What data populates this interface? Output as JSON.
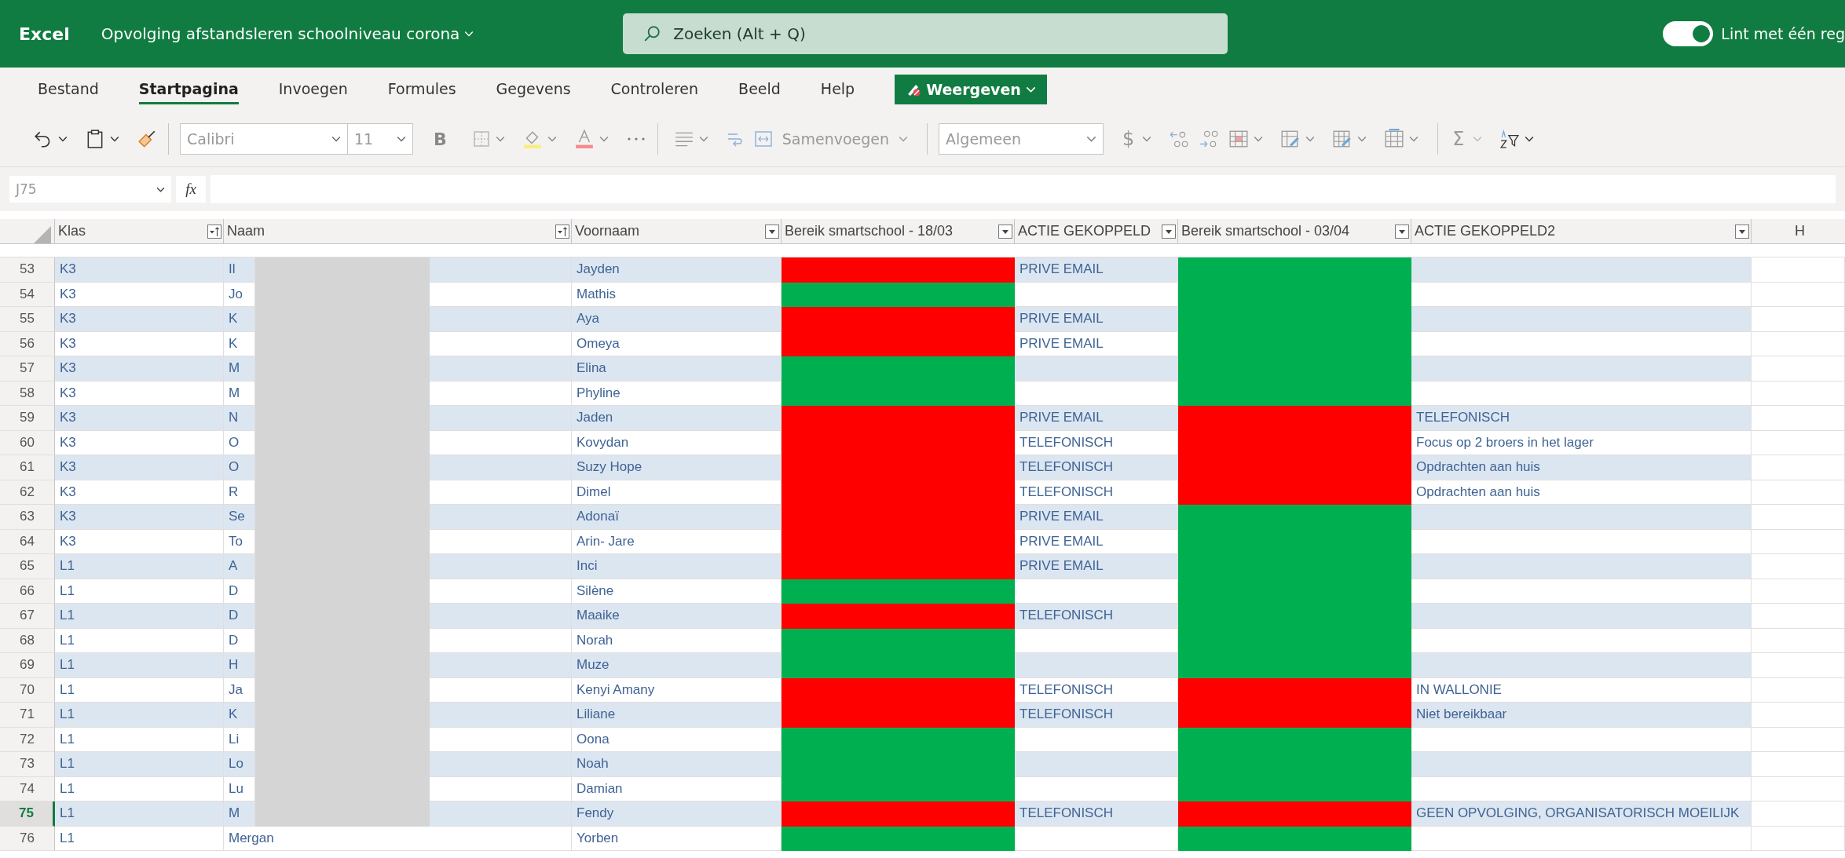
{
  "app_bar": {
    "app_name": "Excel",
    "document_title": "Opvolging afstandsleren schoolniveau corona",
    "search": {
      "placeholder": "Zoeken (Alt + Q)"
    },
    "ribbon_toggle": {
      "label": "Lint met één reg",
      "on": true
    }
  },
  "tabs": [
    {
      "label": "Bestand",
      "selected": false
    },
    {
      "label": "Startpagina",
      "selected": true
    },
    {
      "label": "Invoegen",
      "selected": false
    },
    {
      "label": "Formules",
      "selected": false
    },
    {
      "label": "Gegevens",
      "selected": false
    },
    {
      "label": "Controleren",
      "selected": false
    },
    {
      "label": "Beeld",
      "selected": false
    },
    {
      "label": "Help",
      "selected": false
    }
  ],
  "view_button": {
    "label": "Weergeven"
  },
  "toolbar": {
    "font": "Calibri",
    "font_size": "11",
    "bold": "B",
    "merge": "Samenvoegen",
    "number_format": "Algemeen",
    "currency": "$",
    "sum": "Σ"
  },
  "formula_bar": {
    "name_box": "J75",
    "fx": "fx"
  },
  "columns": [
    {
      "label": "Klas",
      "sorted": true
    },
    {
      "label": "Naam",
      "sorted": true
    },
    {
      "label": "Voornaam",
      "sorted": false
    },
    {
      "label": "Bereik smartschool - 18/03",
      "sorted": false
    },
    {
      "label": "ACTIE GEKOPPELD",
      "sorted": false
    },
    {
      "label": "Bereik smartschool - 03/04",
      "sorted": false
    },
    {
      "label": "ACTIE GEKOPPELD2",
      "sorted": false
    }
  ],
  "extra_column": "H",
  "rows": [
    {
      "number": "53",
      "klas": "K3",
      "naam": "Il",
      "redacted": true,
      "voornaam": "Jayden",
      "reached_1": false,
      "action_1": "PRIVE EMAIL",
      "reached_2": true,
      "action_2": "",
      "selected": false
    },
    {
      "number": "54",
      "klas": "K3",
      "naam": "Jo",
      "redacted": true,
      "voornaam": "Mathis",
      "reached_1": true,
      "action_1": "",
      "reached_2": true,
      "action_2": "",
      "selected": false
    },
    {
      "number": "55",
      "klas": "K3",
      "naam": "K",
      "redacted": true,
      "voornaam": "Aya",
      "reached_1": false,
      "action_1": "PRIVE EMAIL",
      "reached_2": true,
      "action_2": "",
      "selected": false
    },
    {
      "number": "56",
      "klas": "K3",
      "naam": "K",
      "redacted": true,
      "voornaam": "Omeya",
      "reached_1": false,
      "action_1": "PRIVE EMAIL",
      "reached_2": true,
      "action_2": "",
      "selected": false
    },
    {
      "number": "57",
      "klas": "K3",
      "naam": "M",
      "redacted": true,
      "voornaam": "Elina",
      "reached_1": true,
      "action_1": "",
      "reached_2": true,
      "action_2": "",
      "selected": false
    },
    {
      "number": "58",
      "klas": "K3",
      "naam": "M",
      "redacted": true,
      "voornaam": "Phyline",
      "reached_1": true,
      "action_1": "",
      "reached_2": true,
      "action_2": "",
      "selected": false
    },
    {
      "number": "59",
      "klas": "K3",
      "naam": "N",
      "redacted": true,
      "voornaam": "Jaden",
      "reached_1": false,
      "action_1": "PRIVE EMAIL",
      "reached_2": false,
      "action_2": "TELEFONISCH",
      "selected": false
    },
    {
      "number": "60",
      "klas": "K3",
      "naam": "O",
      "redacted": true,
      "voornaam": "Kovydan",
      "reached_1": false,
      "action_1": "TELEFONISCH",
      "reached_2": false,
      "action_2": "Focus op 2 broers in het lager",
      "selected": false
    },
    {
      "number": "61",
      "klas": "K3",
      "naam": "O",
      "redacted": true,
      "voornaam": "Suzy Hope",
      "reached_1": false,
      "action_1": "TELEFONISCH",
      "reached_2": false,
      "action_2": "Opdrachten aan huis",
      "selected": false
    },
    {
      "number": "62",
      "klas": "K3",
      "naam": "R",
      "redacted": true,
      "voornaam": "Dimel",
      "reached_1": false,
      "action_1": "TELEFONISCH",
      "reached_2": false,
      "action_2": "Opdrachten aan huis",
      "selected": false
    },
    {
      "number": "63",
      "klas": "K3",
      "naam": "Se",
      "redacted": true,
      "voornaam": "Adonaï",
      "reached_1": false,
      "action_1": "PRIVE EMAIL",
      "reached_2": true,
      "action_2": "",
      "selected": false
    },
    {
      "number": "64",
      "klas": "K3",
      "naam": "To",
      "redacted": true,
      "voornaam": "Arin- Jare",
      "reached_1": false,
      "action_1": "PRIVE EMAIL",
      "reached_2": true,
      "action_2": "",
      "selected": false
    },
    {
      "number": "65",
      "klas": "L1",
      "naam": "A",
      "redacted": true,
      "voornaam": "Inci",
      "reached_1": false,
      "action_1": "PRIVE EMAIL",
      "reached_2": true,
      "action_2": "",
      "selected": false
    },
    {
      "number": "66",
      "klas": "L1",
      "naam": "D",
      "redacted": true,
      "voornaam": "Silène",
      "reached_1": true,
      "action_1": "",
      "reached_2": true,
      "action_2": "",
      "selected": false
    },
    {
      "number": "67",
      "klas": "L1",
      "naam": "D",
      "redacted": true,
      "voornaam": "Maaike",
      "reached_1": false,
      "action_1": "TELEFONISCH",
      "reached_2": true,
      "action_2": "",
      "selected": false
    },
    {
      "number": "68",
      "klas": "L1",
      "naam": "D",
      "redacted": true,
      "voornaam": "Norah",
      "reached_1": true,
      "action_1": "",
      "reached_2": true,
      "action_2": "",
      "selected": false
    },
    {
      "number": "69",
      "klas": "L1",
      "naam": "H",
      "redacted": true,
      "voornaam": "Muze",
      "reached_1": true,
      "action_1": "",
      "reached_2": true,
      "action_2": "",
      "selected": false
    },
    {
      "number": "70",
      "klas": "L1",
      "naam": "Ja",
      "redacted": true,
      "voornaam": "Kenyi Amany",
      "reached_1": false,
      "action_1": "TELEFONISCH",
      "reached_2": false,
      "action_2": "IN WALLONIE",
      "selected": false
    },
    {
      "number": "71",
      "klas": "L1",
      "naam": "K",
      "redacted": true,
      "voornaam": "Liliane",
      "reached_1": false,
      "action_1": "TELEFONISCH",
      "reached_2": false,
      "action_2": "Niet bereikbaar",
      "selected": false
    },
    {
      "number": "72",
      "klas": "L1",
      "naam": "Li",
      "redacted": true,
      "voornaam": "Oona",
      "reached_1": true,
      "action_1": "",
      "reached_2": true,
      "action_2": "",
      "selected": false
    },
    {
      "number": "73",
      "klas": "L1",
      "naam": "Lo",
      "redacted": true,
      "voornaam": "Noah",
      "reached_1": true,
      "action_1": "",
      "reached_2": true,
      "action_2": "",
      "selected": false
    },
    {
      "number": "74",
      "klas": "L1",
      "naam": "Lu",
      "redacted": true,
      "voornaam": "Damian",
      "reached_1": true,
      "action_1": "",
      "reached_2": true,
      "action_2": "",
      "selected": false
    },
    {
      "number": "75",
      "klas": "L1",
      "naam": "M",
      "redacted": true,
      "voornaam": "Fendy",
      "reached_1": false,
      "action_1": "TELEFONISCH",
      "reached_2": false,
      "action_2": "GEEN OPVOLGING, ORGANISATORISCH MOEILIJK",
      "selected": true
    },
    {
      "number": "76",
      "klas": "L1",
      "naam": "Mergan",
      "redacted": false,
      "voornaam": "Yorben",
      "reached_1": true,
      "action_1": "",
      "reached_2": true,
      "action_2": "",
      "selected": false
    }
  ]
}
